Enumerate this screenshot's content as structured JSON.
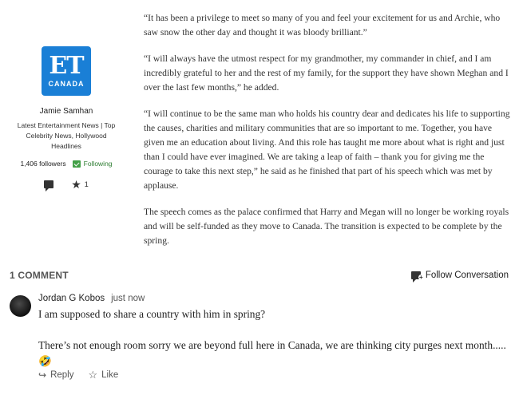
{
  "author": {
    "logo_text": "ET",
    "logo_subtext": "CANADA",
    "name": "Jamie Samhan",
    "description": "Latest Entertainment News | Top Celebrity News, Hollywood Headlines",
    "followers": "1,406 followers",
    "follow_status": "Following",
    "star_count": "1"
  },
  "article": {
    "paragraphs": [
      "“It has been a privilege to meet so many of you and feel your excitement for us and Archie, who saw snow the other day and thought it was bloody brilliant.”",
      "“I will always have the utmost respect for my grandmother, my commander in chief, and I am incredibly grateful to her and the rest of my family, for the support they have shown Meghan and I over the last few months,” he added.",
      "“I will continue to be the same man who holds his country dear and dedicates his life to supporting the causes, charities and military communities that are so important to me. Together, you have given me an education about living. And this role has taught me more about what is right and just than I could have ever imagined. We are taking a leap of faith – thank you for giving me the courage to take this next step,” he said as he finished that part of his speech which was met by applause.",
      "The speech comes as the palace confirmed that Harry and Megan will no longer be working royals and will be self-funded as they move to Canada. The transition is expected to be complete by the spring."
    ]
  },
  "comments_section": {
    "count_label": "1 COMMENT",
    "follow_label": "Follow Conversation"
  },
  "comment": {
    "author": "Jordan G Kobos",
    "timestamp": "just now",
    "line1": "I am supposed to share a country with him in spring?",
    "line2": "There’s not enough room sorry we are beyond full here in Canada, we are thinking city purges next month.....🤣",
    "reply_label": "Reply",
    "like_label": "Like"
  }
}
